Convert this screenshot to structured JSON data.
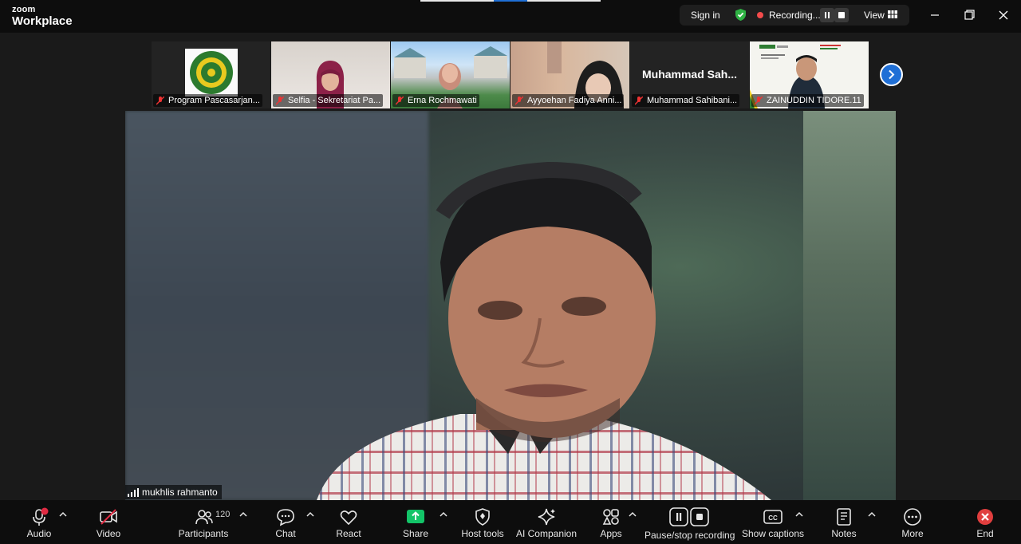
{
  "app": {
    "brand_top": "zoom",
    "brand_bottom": "Workplace"
  },
  "titlebar": {
    "sign_in": "Sign in",
    "recording": "Recording...",
    "view": "View"
  },
  "participants_strip": [
    {
      "name": "Program Pascasarjan...",
      "muted": true
    },
    {
      "name": "Selfia - Sekretariat Pa...",
      "muted": true
    },
    {
      "name": "Erna Rochmawati",
      "muted": true
    },
    {
      "name": "Ayyoehan Fadiya Anni...",
      "muted": true
    },
    {
      "name": "Muhammad Sahibani...",
      "display": "Muhammad  Sah...",
      "muted": true
    },
    {
      "name": "ZAINUDDIN TIDORE.11",
      "muted": true
    }
  ],
  "active_speaker": {
    "name": "mukhlis rahmanto"
  },
  "toolbar": {
    "audio": "Audio",
    "video": "Video",
    "participants": "Participants",
    "participants_count": "120",
    "chat": "Chat",
    "react": "React",
    "share": "Share",
    "host_tools": "Host tools",
    "ai_companion": "AI Companion",
    "apps": "Apps",
    "pause_stop_recording": "Pause/stop recording",
    "show_captions": "Show captions",
    "notes": "Notes",
    "more": "More",
    "end": "End"
  },
  "colors": {
    "accent": "#1f6fd6",
    "record": "#f34b4b",
    "share": "#13c468",
    "end": "#e03e3e",
    "shield": "#2fb344"
  }
}
